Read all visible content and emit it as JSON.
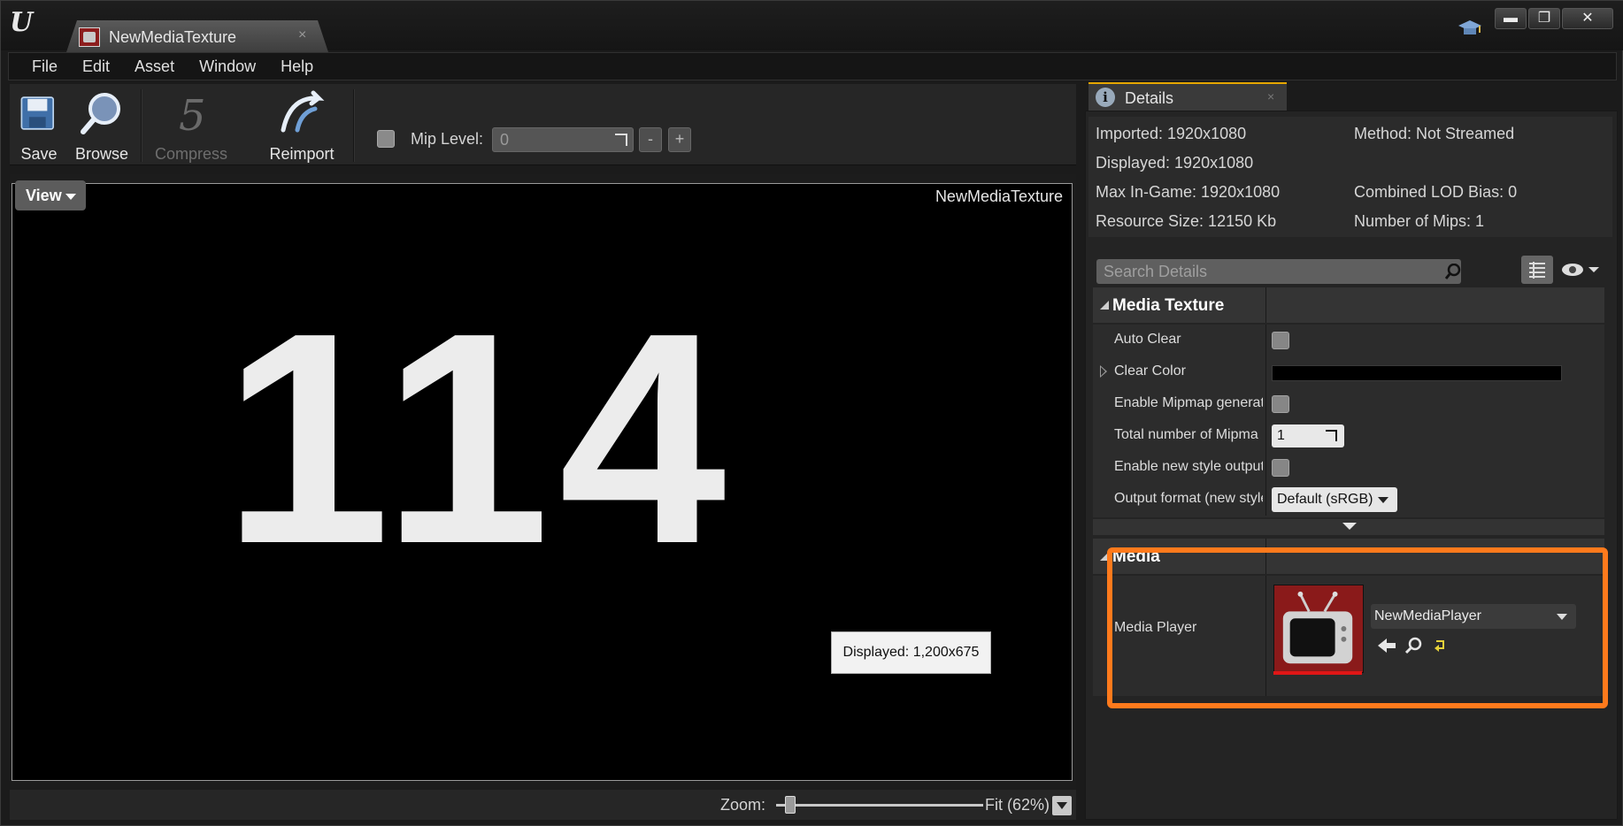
{
  "window": {
    "document_tab": "NewMediaTexture",
    "close_glyph": "×",
    "controls": {
      "minimize": "▬",
      "maximize": "❐",
      "close": "✕"
    }
  },
  "menu": [
    "File",
    "Edit",
    "Asset",
    "Window",
    "Help"
  ],
  "toolbar": {
    "save": "Save",
    "browse": "Browse",
    "compress": "Compress",
    "reimport": "Reimport",
    "mip_label": "Mip Level:",
    "mip_value": "0",
    "minus": "-",
    "plus": "+"
  },
  "viewport": {
    "view_button": "View",
    "asset_name": "NewMediaTexture",
    "frame_text": "114",
    "tooltip": "Displayed: 1,200x675"
  },
  "zoom": {
    "label": "Zoom:",
    "value": "Fit (62%)",
    "level_fraction": 0.07
  },
  "details": {
    "tab_label": "Details",
    "tab_close": "×",
    "stats": {
      "imported": "Imported: 1920x1080",
      "method": "Method: Not Streamed",
      "displayed": "Displayed: 1920x1080",
      "max_in_game": "Max In-Game: 1920x1080",
      "lod_bias": "Combined LOD Bias: 0",
      "resource_size": "Resource Size: 12150 Kb",
      "num_mips": "Number of Mips: 1"
    },
    "search_placeholder": "Search Details",
    "sections": {
      "media_texture": {
        "title": "Media Texture",
        "auto_clear": "Auto Clear",
        "clear_color": "Clear Color",
        "enable_mipmap": "Enable Mipmap generat",
        "total_mips": "Total number of Mipma",
        "total_mips_value": "1",
        "new_style_output": "Enable new style output",
        "output_format": "Output format (new style",
        "output_format_value": "Default (sRGB)"
      },
      "media": {
        "title": "Media",
        "media_player_label": "Media Player",
        "media_player_value": "NewMediaPlayer"
      }
    }
  },
  "colors": {
    "highlight": "#ff7a1c",
    "accent_tab": "#e5a600",
    "thumbnail_red": "#a82828"
  }
}
